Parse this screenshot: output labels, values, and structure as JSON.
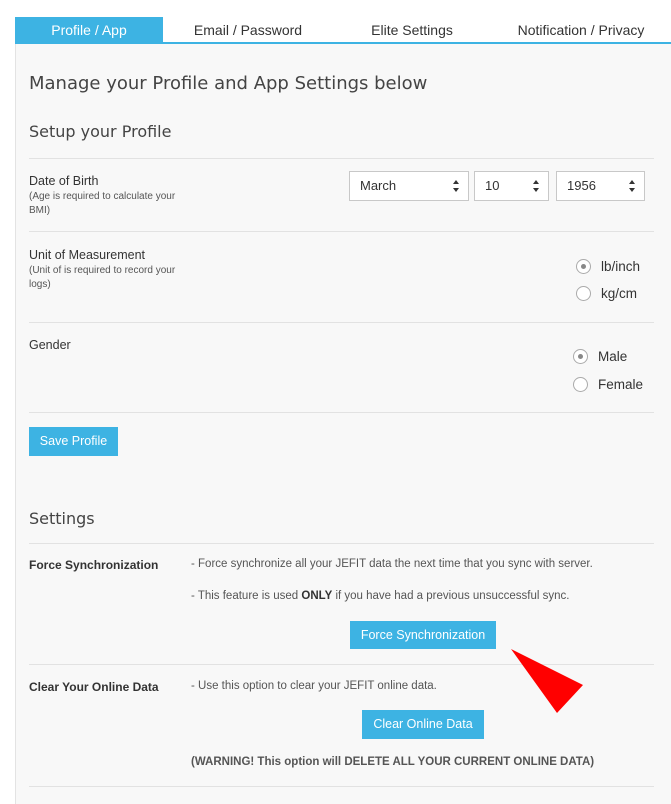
{
  "tabs": [
    {
      "label": "Profile / App",
      "active": true
    },
    {
      "label": "Email / Password",
      "active": false
    },
    {
      "label": "Elite Settings",
      "active": false
    },
    {
      "label": "Notification / Privacy",
      "active": false
    }
  ],
  "page": {
    "title": "Manage your Profile and App Settings below",
    "profile_heading": "Setup your Profile",
    "settings_heading": "Settings"
  },
  "profile": {
    "dob": {
      "label": "Date of Birth",
      "note": "(Age is required to calculate your BMI)",
      "month": "March",
      "day": "10",
      "year": "1956"
    },
    "unit": {
      "label": "Unit of Measurement",
      "note": "(Unit of is required to record your logs)",
      "options": [
        {
          "label": "lb/inch",
          "selected": true
        },
        {
          "label": "kg/cm",
          "selected": false
        }
      ]
    },
    "gender": {
      "label": "Gender",
      "options": [
        {
          "label": "Male",
          "selected": true
        },
        {
          "label": "Female",
          "selected": false
        }
      ]
    },
    "save_label": "Save Profile"
  },
  "settings": {
    "force_sync": {
      "label": "Force Synchronization",
      "desc1": "- Force synchronize all your JEFIT data the next time that you sync with server.",
      "desc2_pre": "- This feature is used ",
      "desc2_bold": "ONLY",
      "desc2_post": " if you have had a previous unsuccessful sync.",
      "button_label": "Force Synchronization"
    },
    "clear_data": {
      "label": "Clear Your Online Data",
      "desc": "- Use this option to clear your JEFIT online data.",
      "button_label": "Clear Online Data",
      "warning": "(WARNING! This option will DELETE ALL YOUR CURRENT ONLINE DATA)"
    }
  },
  "colors": {
    "accent": "#3db3e3",
    "annotation_arrow": "#ff0000"
  }
}
